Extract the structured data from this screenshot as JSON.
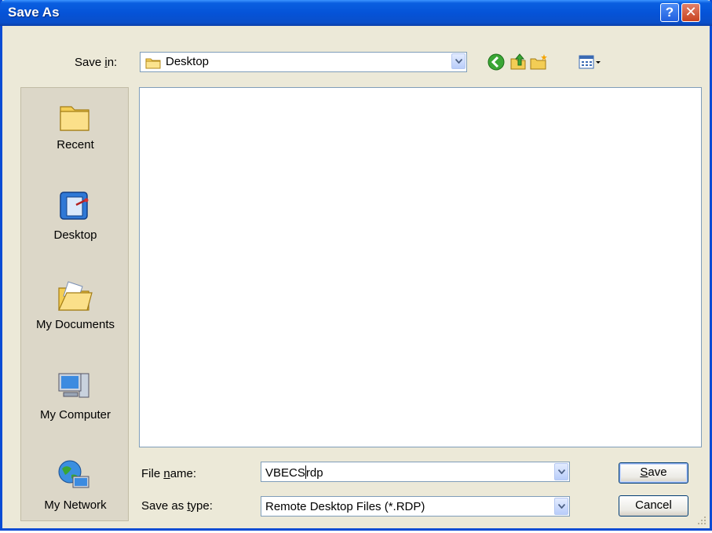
{
  "window": {
    "title": "Save As",
    "help_glyph": "?",
    "close_glyph": "✕"
  },
  "toolbar": {
    "save_in_label_pre": "Save ",
    "save_in_label_ul": "i",
    "save_in_label_post": "n:",
    "location": "Desktop",
    "icons": [
      "back-icon",
      "up-folder-icon",
      "new-folder-icon",
      "views-menu-icon"
    ]
  },
  "places": [
    {
      "label": "Recent",
      "icon": "recent-folder-icon"
    },
    {
      "label": "Desktop",
      "icon": "desktop-icon"
    },
    {
      "label": "My Documents",
      "icon": "my-documents-icon"
    },
    {
      "label": "My Computer",
      "icon": "my-computer-icon"
    },
    {
      "label": "My Network",
      "icon": "my-network-icon"
    }
  ],
  "form": {
    "file_name_pre": "File ",
    "file_name_ul": "n",
    "file_name_post": "ame:",
    "file_name_before_caret": "VBECS",
    "file_name_after_caret": "rdp",
    "type_pre": "Save as ",
    "type_ul": "t",
    "type_post": "ype:",
    "type_value": "Remote Desktop Files (*.RDP)"
  },
  "buttons": {
    "save_ul": "S",
    "save_rest": "ave",
    "cancel": "Cancel"
  },
  "colors": {
    "titlebar": "#0553d8",
    "dialog_bg": "#ece9d8",
    "places_bg": "#dcd7c8"
  }
}
